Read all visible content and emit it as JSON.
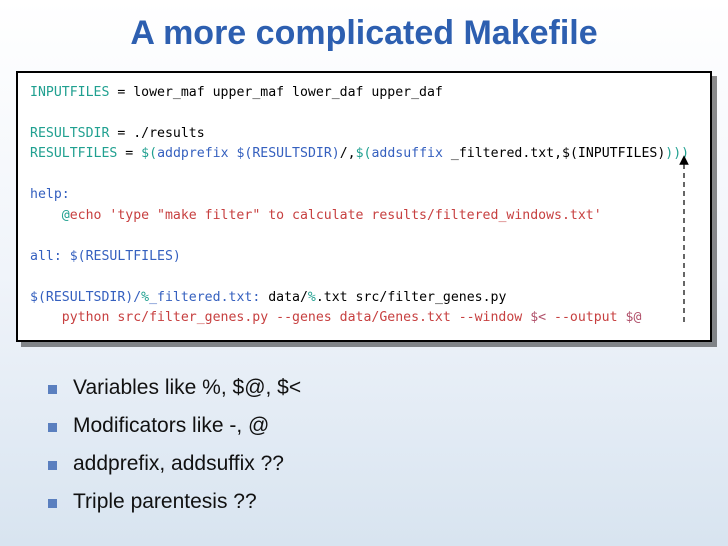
{
  "title": "A more complicated Makefile",
  "code": {
    "l1a": "INPUTFILES",
    "l1b": " = lower_maf upper_maf lower_daf upper_daf",
    "l2a": "RESULTSDIR",
    "l2b": " = ./results",
    "l3a": "RESULTFILES",
    "l3b": " = ",
    "l3c": "$(",
    "l3d": "addprefix",
    "l3e": " ",
    "l3f": "$(RESULTSDIR)",
    "l3g": "/,",
    "l3h": "$(",
    "l3i": "addsuffix",
    "l3j": " _filtered.txt,$(INPUTFILES)",
    "l3k": ")))",
    "l4a": "help:",
    "l5a": "    @",
    "l5b": "echo 'type \"make filter\" to calculate results/filtered_windows.txt'",
    "l6a": "all:",
    "l6b": " $(RESULTFILES)",
    "l7a": "$(RESULTSDIR)/",
    "l7b": "%",
    "l7c": "_filtered.txt:",
    "l7d": " data/",
    "l7e": "%",
    "l7f": ".txt src/filter_genes.py",
    "l8a": "    python src/filter_genes.py --genes data/Genes.txt --window ",
    "l8b": "$<",
    "l8c": " --output ",
    "l8d": "$@"
  },
  "bullets": [
    "Variables like %, $@, $<",
    "Modificators like -, @",
    "addprefix, addsuffix ??",
    "Triple parentesis ??"
  ]
}
